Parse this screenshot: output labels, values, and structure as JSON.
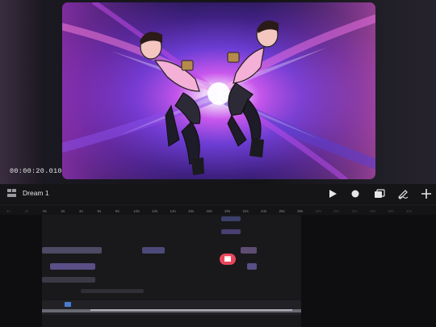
{
  "viewer": {
    "timecode": "00:00:20.010"
  },
  "project": {
    "name": "Dream 1"
  },
  "toolbar": {
    "buttons": [
      {
        "name": "play-button",
        "icon": "play-icon"
      },
      {
        "name": "record-button",
        "icon": "record-icon"
      },
      {
        "name": "overlay-button",
        "icon": "layers-icon"
      },
      {
        "name": "draw-button",
        "icon": "pen-icon"
      },
      {
        "name": "add-button",
        "icon": "plus-icon"
      }
    ]
  },
  "ruler": {
    "ticks": [
      "4s",
      "2s",
      "0s",
      "2s",
      "4s",
      "6s",
      "8s",
      "10s",
      "12s",
      "14s",
      "16s",
      "18s",
      "20s",
      "22s",
      "24s",
      "26s",
      "28s",
      "30s",
      "32s",
      "34s",
      "36s",
      "38s",
      "40s"
    ]
  },
  "colors": {
    "accent": "#e9465b",
    "clip": "#5a4f86"
  }
}
